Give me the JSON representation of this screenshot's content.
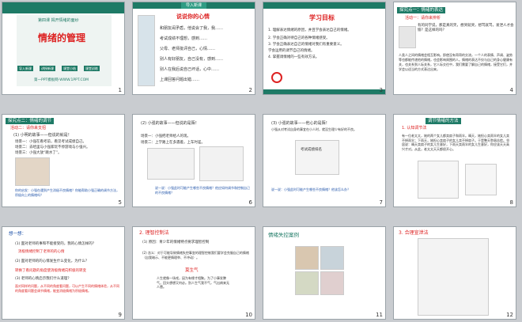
{
  "slides": [
    {
      "num": "1",
      "subtitle": "第四课 揭开情绪的面纱",
      "title": "情绪的管理",
      "buttons": [
        "导入新课",
        "讲授新课",
        "课堂小结",
        "课堂训练"
      ],
      "footer": "第一PPT模板网-WWW.1PPT.COM"
    },
    {
      "num": "2",
      "header": "导入新课",
      "title": "说说你的心情",
      "lines": [
        "和朋友闹矛盾，他说会了我，我……",
        "考试成绩不理想，感到……",
        "父母、老师批评自己，心情……",
        "别人有好朋友，自己没有，感到……",
        "别人在我后说自己坏话，心中……",
        "上课回答问题出错……"
      ]
    },
    {
      "num": "3",
      "title": "学习目标",
      "lines": [
        "1. 理解表达情绪的原因，并且学会表达自己的情绪。",
        "2. 学会正确对待自己的各种情绪感受。",
        "3. 学会正确表达自己的情绪对我们有重要意义。",
        "学会运用的调节自己的情绪。",
        "4. 掌握调情绪的一些有效方法。"
      ]
    },
    {
      "num": "4",
      "header": "探究点一：情绪的表达",
      "subheader": "活动一：请你来辨析",
      "q1": "有的同学说，那是真的笑，想哭就哭，想骂就骂，发泄人才会愉？是这样的吗？",
      "p1": "人类人之间的情绪会相互影响。即使没有哥哥的交流，一个人的表情、声调、姿势等也都能传递他的情绪，也会影响周围的人。情绪的表达不仅与自己的身心健康有关，也关系到人际关系，它人际交往中，我们需要了解自己的情绪，接受它们，并学会以适当的方式表达出来。"
    },
    {
      "num": "5",
      "header": "探究点二：情绪的调节",
      "subheader": "活动二：请你来支招",
      "q": "(1) 小明的故事——但说的就是！",
      "items": [
        "场景一：小强在看考前，看见考试成绩自己。",
        "场景二：去哈里与小强家玩不停游戏与小强兴。",
        "场景三：小强大放“跳水了”。"
      ],
      "note": "你的启发：小强在遇到产生消极不良情绪？你能帮助小强正确的调节方法，积极向上的情绪吗？"
    },
    {
      "num": "6",
      "q": "(2) 小强的故事——但说的是陌！",
      "scene1": "场景一：小强把老师给人的现。",
      "scene2": "场景二：上学路上在多遇着，上车时差。",
      "think": "说一说：小强此时可能产生哪些不良情绪？他应如何调节和控制自己的不良情绪？"
    },
    {
      "num": "7",
      "q": "(3) 小强的故事——他心的是陌！",
      "desc": "小强从对考试自身的事宜在小人时，就没生理少有好的不良。",
      "poster": "考试成绩排名",
      "think": "说一说：小强此时可能产生哪些不良情绪？他该怎么办？"
    },
    {
      "num": "8",
      "header": "调节情绪的方法",
      "sub": "1. 认知调节法",
      "p": "有一位老太太，她的两个女儿都卖扇子和雨伞。晴天，她担心卖雨伞的女儿卖不掉雨伞；下雨天，她担心卖扇子的女儿卖不掉扇子。于是整天愁眉苦脸。邻居说：晴天卖扇子的女儿生意好，下雨天卖雨伞的女儿生意好，你应该天天高兴才对。从此，老太太天天都很开心。"
    },
    {
      "num": "9",
      "head": "想一想：",
      "q1": "(1) 面对老师的事和不能接受的，我的心情怎样的？",
      "a1": "消极情绪控制了老师的的心情",
      "q2": "(2) 面对老师的的心情发生什么变化，为什么？",
      "a2": "转换了看问题的角度使消极情绪向积极的转变",
      "q3": "(3) 老师的心情启示我们什么道理？",
      "note": "面对同样的问题，从不同的角度看问题，可以产生不同的情绪体验，从不同的角度看问题会调节情绪，能变消极情绪为积极情绪。"
    },
    {
      "num": "10",
      "head": "2. 理智控制法",
      "l1": "(1) 原因：青少年的情绪特点要求理智控制",
      "l2": "(2) 含义：对于可能导致情绪失控事宜的理智控制我们要学会克服自己的情绪（自我暗示、不能更情理举、不冲动）。",
      "poem": "莫生气",
      "p": "人生就像一场戏，因为有缘才相聚。为了小事发脾气，回头想想又何必。别人生气我不气，气出病来无人替。"
    },
    {
      "num": "11",
      "title": "情绪失控案例"
    },
    {
      "num": "12",
      "head": "3. 合理宣泄法"
    }
  ]
}
